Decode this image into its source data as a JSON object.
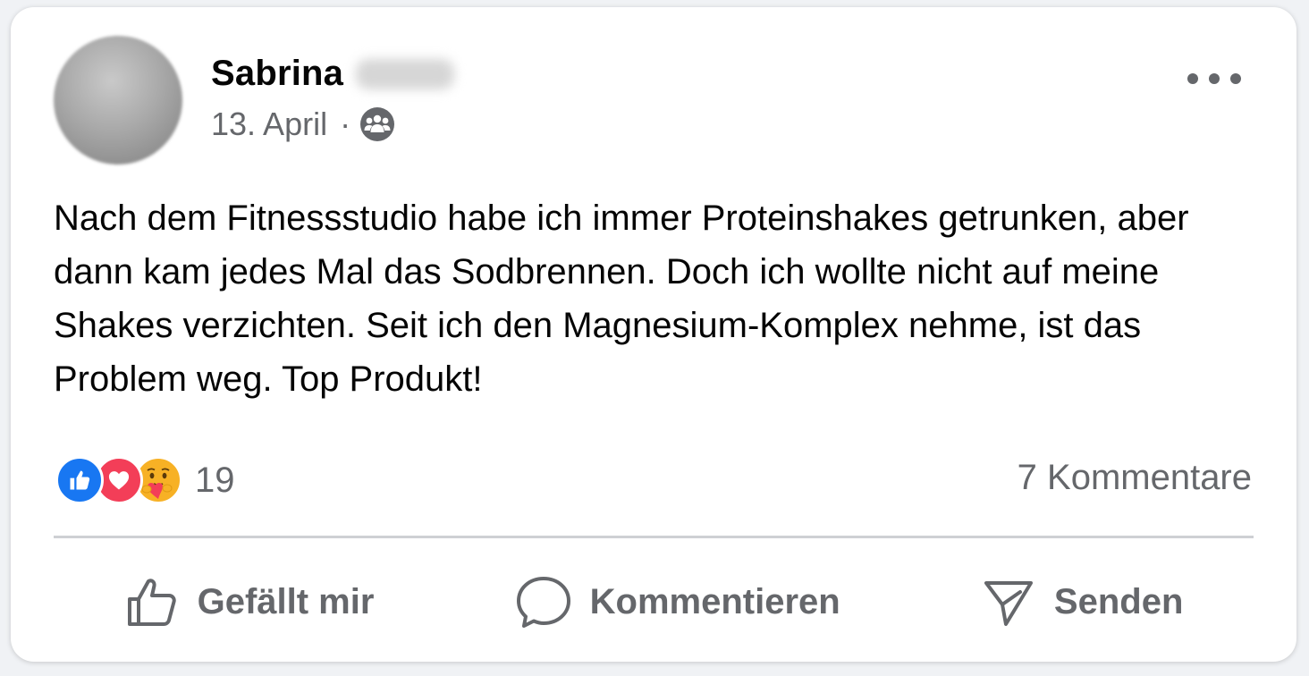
{
  "post": {
    "author_name": "Sabrina",
    "date": "13. April",
    "separator": "·",
    "audience_icon": "group-icon",
    "body": "Nach dem Fitnessstudio habe ich immer Proteinshakes getrunken, aber dann kam jedes Mal das Sodbrennen. Doch ich wollte nicht auf meine Shakes verzichten. Seit ich den Magnesium-Komplex nehme, ist das Problem weg. Top Produkt!",
    "more_icon": "more-options-icon"
  },
  "stats": {
    "reactions": [
      "like-reaction-icon",
      "love-reaction-icon",
      "care-reaction-icon"
    ],
    "reaction_count": "19",
    "comments": "7 Kommentare"
  },
  "actions": {
    "like_label": "Gefällt mir",
    "comment_label": "Kommentieren",
    "share_label": "Senden"
  },
  "colors": {
    "like_blue": "#1877f2",
    "love_red": "#f33e58",
    "care_yellow": "#f7b125",
    "secondary_text": "#65676b",
    "primary_text": "#050505"
  }
}
